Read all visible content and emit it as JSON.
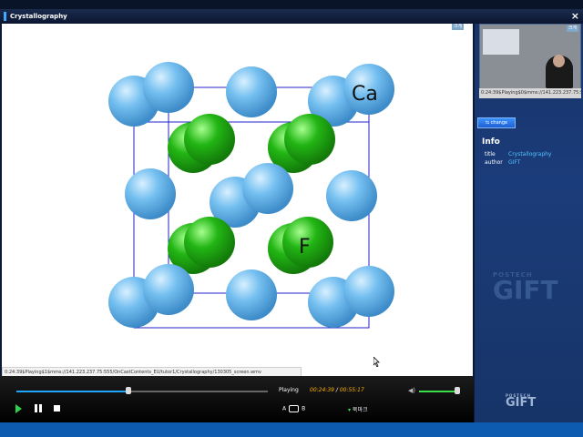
{
  "window": {
    "title": "Crystallography",
    "close_glyph": "×"
  },
  "slide": {
    "badge": "크게",
    "labels": {
      "ca": "Ca",
      "f": "F"
    },
    "colors": {
      "ca": "#66b6ee",
      "f": "#1faa12",
      "frame": "#2020cc"
    }
  },
  "path_bar": {
    "text": "0:24:39$Playing$1$mms://141.223.237.75:555/OnCastContents_EU/tutor1/Crystallography/130305_screen.wmv"
  },
  "video": {
    "badge": "크게",
    "status": "0:24:39$Playing$0$mms://141.223.237.75:5"
  },
  "change_button": {
    "label": "change"
  },
  "info": {
    "heading": "Info",
    "rows": [
      {
        "key": "title",
        "value": "Crystallography"
      },
      {
        "key": "author",
        "value": "GIFT"
      }
    ]
  },
  "watermark": {
    "line1": "POSTECH",
    "line2": "GIFT"
  },
  "player": {
    "state": "Playing",
    "current_time": "00:24:39",
    "separator": "/",
    "total_time": "00:55:17",
    "progress": 0.447,
    "volume": 0.95,
    "a_label": "A",
    "b_label": "B",
    "bookmark_label": "북마크"
  },
  "logo": {
    "line1": "POSTECH",
    "line2": "GIFT"
  }
}
